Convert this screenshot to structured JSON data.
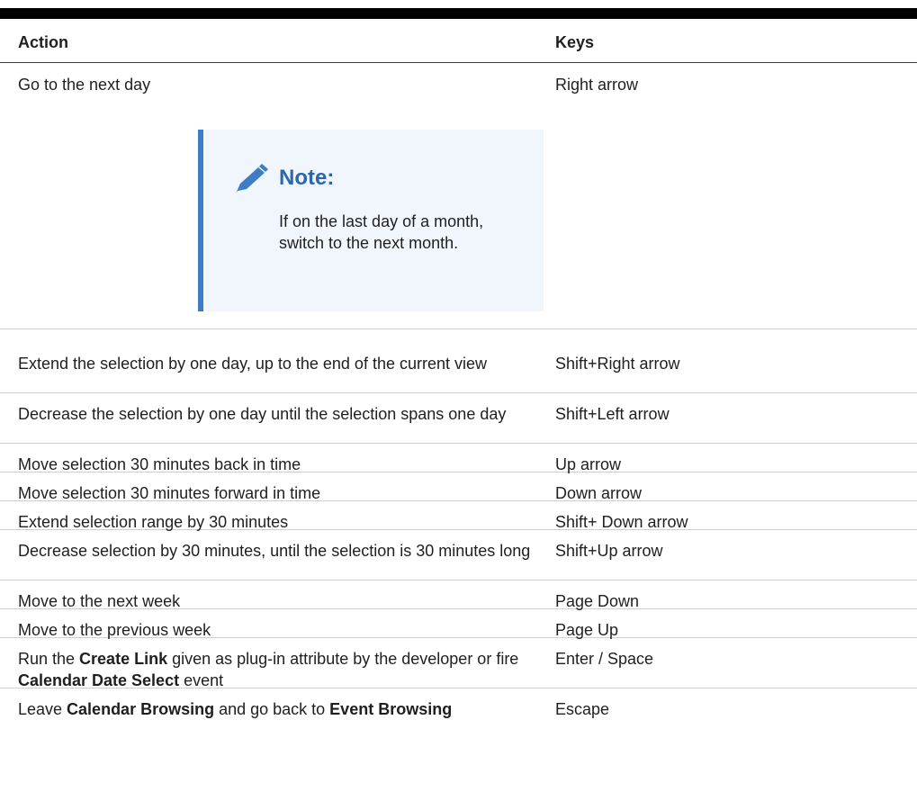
{
  "table": {
    "header": {
      "action": "Action",
      "keys": "Keys"
    },
    "rows": [
      {
        "action": "Go to the next day",
        "keys": "Right arrow"
      },
      {
        "action": "Extend the selection by one day, up to the end of the current view",
        "keys": "Shift+Right arrow"
      },
      {
        "action": "Decrease the selection by one day until the selection spans one day",
        "keys": "Shift+Left arrow"
      },
      {
        "action": "Move selection 30 minutes back in time",
        "keys": "Up arrow"
      },
      {
        "action": "Move selection 30 minutes forward in time",
        "keys": "Down arrow"
      },
      {
        "action": "Extend selection range by 30 minutes",
        "keys": "Shift+ Down arrow"
      },
      {
        "action": "Decrease selection by 30 minutes, until the selection is 30 minutes long",
        "keys": "Shift+Up arrow"
      },
      {
        "action": "Move to the next week",
        "keys": "Page Down"
      },
      {
        "action": "Move to the previous week",
        "keys": "Page Up"
      },
      {
        "action_parts": [
          "Run the ",
          "Create Link",
          " given as plug-in attribute by the developer or fire ",
          "Calendar Date Select",
          " event"
        ],
        "keys": "Enter / Space"
      },
      {
        "action_parts": [
          "Leave ",
          "Calendar Browsing",
          " and go back to ",
          "Event Browsing"
        ],
        "keys": "Escape"
      }
    ]
  },
  "note": {
    "icon": "pencil-icon",
    "title": "Note:",
    "body": "If on the last day of a month, switch to the next month."
  },
  "colors": {
    "note_background": "#f1f6fc",
    "note_accent": "#3e7cc6",
    "note_title": "#2c66ad"
  }
}
